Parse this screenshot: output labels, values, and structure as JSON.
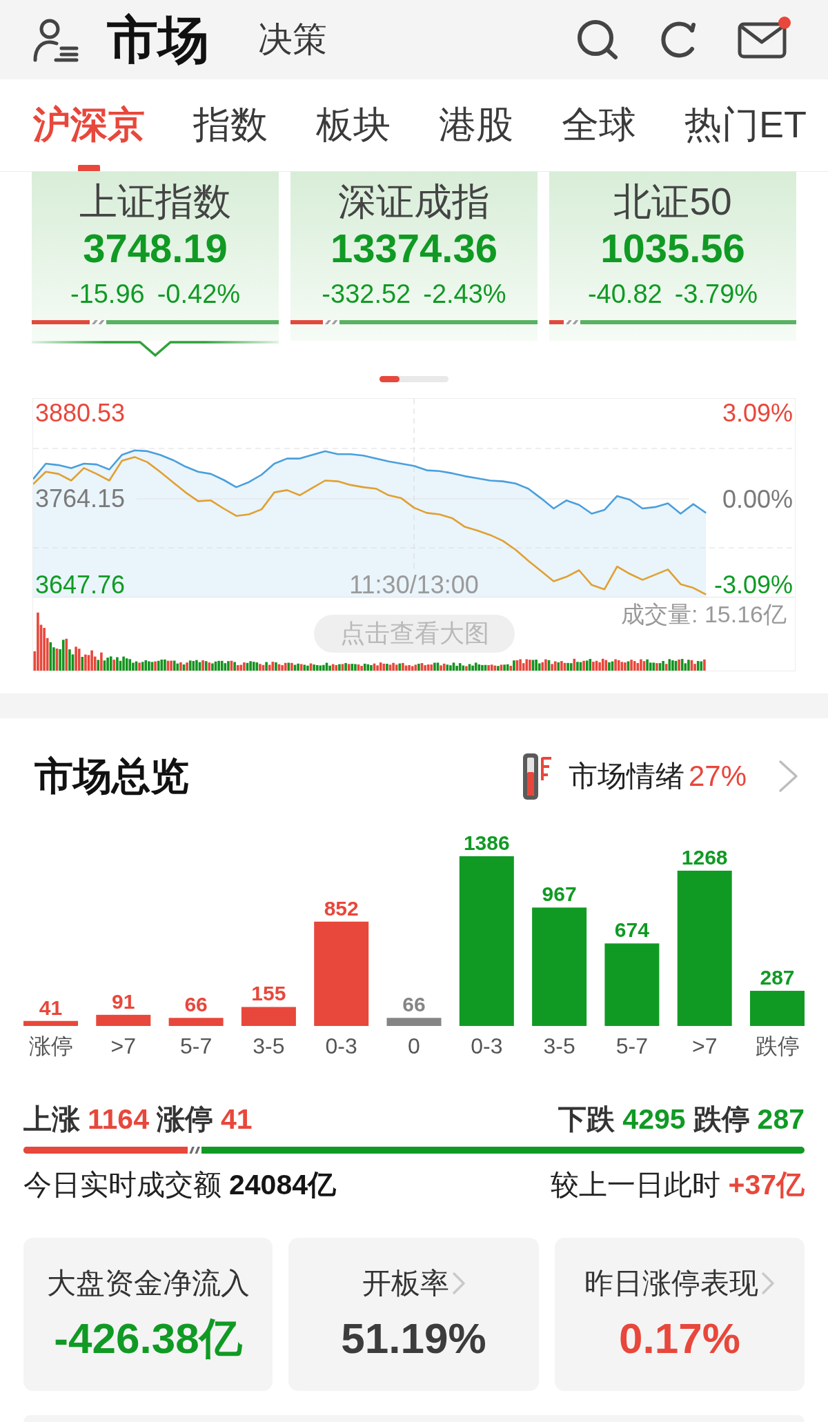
{
  "header": {
    "tabs": [
      {
        "label": "市场",
        "selected": true
      },
      {
        "label": "决策",
        "selected": false
      }
    ],
    "mail_unread": true
  },
  "tabs": [
    {
      "label": "沪深京",
      "selected": true
    },
    {
      "label": "指数",
      "selected": false
    },
    {
      "label": "板块",
      "selected": false
    },
    {
      "label": "港股",
      "selected": false
    },
    {
      "label": "全球",
      "selected": false
    },
    {
      "label": "热门ET",
      "selected": false
    }
  ],
  "index_cards": [
    {
      "name": "上证指数",
      "value": "3748.19",
      "change": "-15.96",
      "change_percent": "-0.42%",
      "rising": false,
      "selected": true,
      "breadth": {
        "level": 0.235
      }
    },
    {
      "name": "深证成指",
      "value": "13374.36",
      "change": "-332.52",
      "change_percent": "-2.43%",
      "rising": false,
      "selected": false,
      "breadth": {
        "level": 0.13
      }
    },
    {
      "name": "北证50",
      "value": "1035.56",
      "change": "-40.82",
      "change_percent": "-3.79%",
      "rising": false,
      "selected": false,
      "breadth": {
        "level": 0.06
      }
    }
  ],
  "intraday_chart": {
    "chart_data": {
      "type": "area",
      "ylim": [
        3629.93,
        3900.24
      ],
      "yticks": [
        {
          "value": 3880.53,
          "label": "3880.53"
        },
        {
          "value": 3764.15,
          "label": "3764.15"
        },
        {
          "value": 3647.76,
          "label": "3647.76"
        }
      ],
      "ref_lines": [
        {
          "axis": "y",
          "value": 3832.66
        },
        {
          "axis": "y",
          "value": 3764.15
        },
        {
          "axis": "y",
          "value": 3697.5
        }
      ],
      "series": [
        {
          "color": "#4a9fdc",
          "values": [
            3791,
            3812,
            3810,
            3806,
            3812,
            3811,
            3804,
            3824,
            3830,
            3829,
            3824,
            3817,
            3808,
            3801,
            3798,
            3790,
            3780,
            3787,
            3797,
            3812,
            3819,
            3819,
            3824,
            3829,
            3825,
            3825,
            3823,
            3819,
            3815,
            3812,
            3809,
            3803,
            3802,
            3799,
            3795,
            3792,
            3789,
            3788,
            3785,
            3778,
            3765,
            3751,
            3762,
            3756,
            3744,
            3749,
            3768,
            3763,
            3751,
            3753,
            3758,
            3744,
            3757,
            3745,
            null,
            null,
            null,
            null,
            null,
            null,
            null
          ]
        },
        {
          "color": "#e0a030",
          "values": [
            3784,
            3801,
            3798,
            3789,
            3806,
            3798,
            3789,
            3816,
            3821,
            3814,
            3801,
            3787,
            3773,
            3761,
            3762,
            3751,
            3741,
            3743,
            3750,
            3773,
            3776,
            3769,
            3779,
            3789,
            3788,
            3783,
            3780,
            3778,
            3769,
            3765,
            3752,
            3745,
            3743,
            3738,
            3726,
            3721,
            3715,
            3707,
            3695,
            3680,
            3666,
            3652,
            3658,
            3667,
            3647,
            3641,
            3672,
            3662,
            3654,
            3661,
            3668,
            3648,
            3643,
            3634,
            null,
            null,
            null,
            null,
            null,
            null,
            null
          ]
        }
      ]
    },
    "percent_labels": [
      "3.09%",
      "0.00%",
      "-3.09%"
    ],
    "time_label": "11:30/13:00",
    "volume_label": "成交量: 15.16亿",
    "enlarge_button": "点击查看大图"
  },
  "market_overview": {
    "title": "市场总览",
    "sentiment": {
      "label": "市场情绪",
      "value": "27%"
    },
    "distribution": {
      "chart_data": {
        "type": "bar",
        "categories": [
          "涨停",
          ">7",
          "5-7",
          "3-5",
          "0-3",
          "0",
          "0-3",
          "3-5",
          "5-7",
          ">7",
          "跌停"
        ],
        "series": [
          {
            "color": "#e8473b",
            "values": [
              41,
              91,
              66,
              155,
              852,
              null,
              null,
              null,
              null,
              null,
              null
            ]
          },
          {
            "color": "#858585",
            "values": [
              null,
              null,
              null,
              null,
              null,
              66,
              null,
              null,
              null,
              null,
              null
            ]
          },
          {
            "color": "#109a24",
            "values": [
              null,
              null,
              null,
              null,
              null,
              null,
              1386,
              967,
              674,
              1268,
              287
            ]
          }
        ],
        "stacked": true,
        "data_labels": true
      }
    },
    "advance_decline": {
      "rise_label": "上涨",
      "rise_count": "1164",
      "limit_up_label": "涨停",
      "limit_up_count": "41",
      "fall_label": "下跌",
      "fall_count": "4295",
      "limit_down_label": "跌停",
      "limit_down_count": "287",
      "bar": {
        "level": 0.21
      }
    },
    "turnover": {
      "label": "今日实时成交额",
      "value": "24084亿",
      "compare_label": "较上一日此时",
      "compare_value": "+37亿"
    },
    "stat_cards": [
      {
        "title": "大盘资金净流入",
        "value": "-426.38亿",
        "color": "#109a24",
        "chevron": false
      },
      {
        "title": "开板率",
        "value": "51.19%",
        "color": "#3c3c3c",
        "chevron": true
      },
      {
        "title": "昨日涨停表现",
        "value": "0.17%",
        "color": "#e8473b",
        "chevron": true
      }
    ]
  }
}
